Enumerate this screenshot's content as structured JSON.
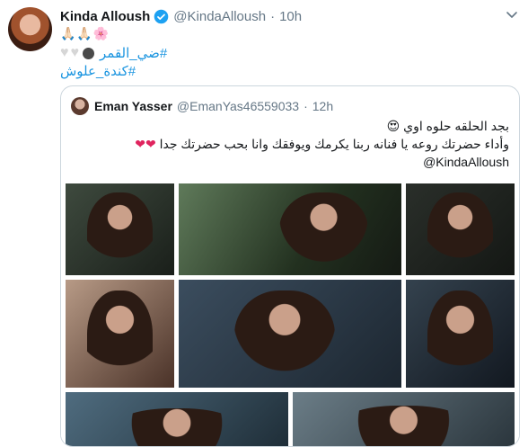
{
  "tweet": {
    "author_name": "Kinda Alloush",
    "author_handle": "@KindaAlloush",
    "separator": "·",
    "time": "10h",
    "emoji_line": "🙏🏻🙏🏻🌸",
    "hashtag1": "#ضي_القمر",
    "hashtag2": "#كندة_علوش"
  },
  "quoted": {
    "author_name": "Eman Yasser",
    "author_handle": "@EmanYas46559033",
    "separator": "·",
    "time": "12h",
    "line1": "بجد الحلقه حلوه اوي",
    "line1_emoji": "😍",
    "line2": "وأداء حضرتك روعه يا فنانه ربنا يكرمك ويوفقك وانا بحب حضرتك جدا",
    "line2_emoji": "❤❤",
    "mention": "@KindaAlloush"
  },
  "icons": {
    "verified": "verified-badge-icon",
    "chevron": "chevron-down-icon",
    "hearts": "white-heart-icon",
    "ball": "dark-circle-emoji-icon"
  },
  "colors": {
    "link": "#1b95e0",
    "verified": "#1da1f2",
    "muted": "#657786",
    "border": "#ccd6dd",
    "heart_red": "#e0245e"
  }
}
